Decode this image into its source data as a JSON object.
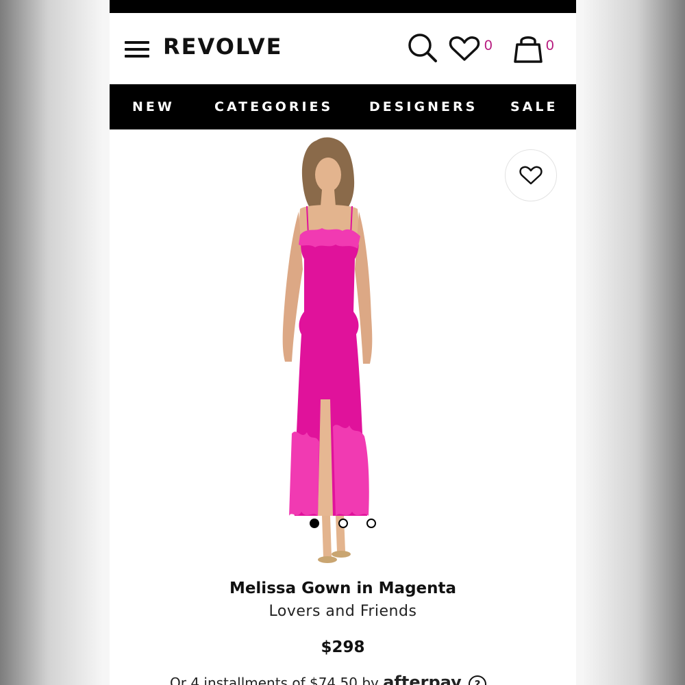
{
  "header": {
    "logo": "REVOLVE",
    "wishlist_count": "0",
    "bag_count": "0"
  },
  "nav": {
    "items": [
      "NEW",
      "CATEGORIES",
      "DESIGNERS",
      "SALE"
    ]
  },
  "product": {
    "title": "Melissa Gown in Magenta",
    "brand": "Lovers and Friends",
    "price": "$298",
    "installments_text": "Or 4 installments of $74.50 by",
    "afterpay_label": "afterpay",
    "help_label": "?",
    "dress_color": "#e0129b",
    "image_count": 3,
    "active_image": 1
  },
  "colors": {
    "accent": "#b5167c",
    "nav_bg": "#000000"
  }
}
